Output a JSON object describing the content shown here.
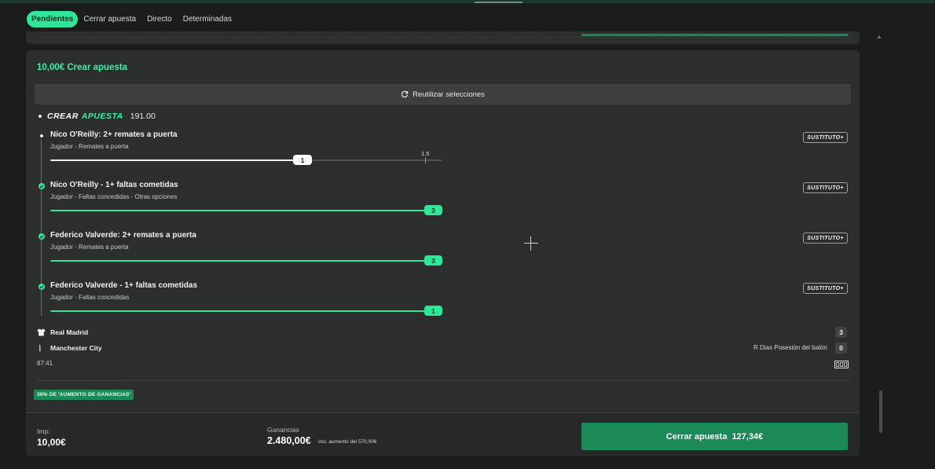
{
  "tabs": [
    {
      "label": "Pendientes",
      "active": true
    },
    {
      "label": "Cerrar apuesta",
      "active": false
    },
    {
      "label": "Directo",
      "active": false
    },
    {
      "label": "Determinadas",
      "active": false
    }
  ],
  "bet": {
    "title": "10,00€  Crear apuesta",
    "reuse_label": "Reutilizar selecciones",
    "builder": {
      "word1": "CREAR",
      "word2": "APUESTA",
      "odds": "191.00"
    },
    "selections": [
      {
        "name": "Nico O'Reilly: 2+ remates a puerta",
        "subtitle": "Jugador - Remates a puerta",
        "substitute_label": "SUSTITUTO+",
        "status": "pending",
        "current_value": "1",
        "target_value": "1.5",
        "progress_fraction": 0.67
      },
      {
        "name": "Nico O'Reilly - 1+ faltas cometidas",
        "subtitle": "Jugador - Faltas concedidas - Otras opciones",
        "substitute_label": "SUSTITUTO+",
        "status": "won",
        "current_value": "3",
        "progress_fraction": 1.0
      },
      {
        "name": "Federico Valverde: 2+ remates a puerta",
        "subtitle": "Jugador - Remates a puerta",
        "substitute_label": "SUSTITUTO+",
        "status": "won",
        "current_value": "3",
        "progress_fraction": 1.0
      },
      {
        "name": "Federico Valverde - 1+ faltas cometidas",
        "subtitle": "Jugador - Faltas concedidas",
        "substitute_label": "SUSTITUTO+",
        "status": "won",
        "current_value": "1",
        "progress_fraction": 1.0
      }
    ],
    "match": {
      "home_team": "Real Madrid",
      "away_team": "Manchester City",
      "home_score": "3",
      "away_score": "0",
      "stat_label": "R Dias Posesión del balón",
      "time": "87:41"
    },
    "boost_label": "30% DE 'AUMENTO DE GANANCIAS'",
    "footer": {
      "stake_label": "Imp:",
      "stake_value": "10,00€",
      "winnings_label": "Ganancias",
      "winnings_value": "2.480,00€",
      "winnings_note": "incl. aumento del 570,00€",
      "cashout_label": "Cerrar apuesta",
      "cashout_amount": "127,34€"
    }
  },
  "colors": {
    "accent": "#2ee899",
    "accent_dark": "#1c8a57",
    "background": "#1b1c1c",
    "card": "#2b2e2d"
  }
}
